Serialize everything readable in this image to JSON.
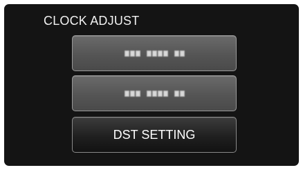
{
  "screen": {
    "title": "CLOCK ADJUST"
  },
  "menu": {
    "items": [
      {
        "label": "",
        "state": "blurred-placeholder"
      },
      {
        "label": "",
        "state": "blurred-placeholder"
      },
      {
        "label": "DST SETTING",
        "state": "normal"
      }
    ]
  },
  "colors": {
    "background": "#141414",
    "button_gray": "#555555",
    "button_dark": "#1e1e1e",
    "text": "#ffffff"
  }
}
